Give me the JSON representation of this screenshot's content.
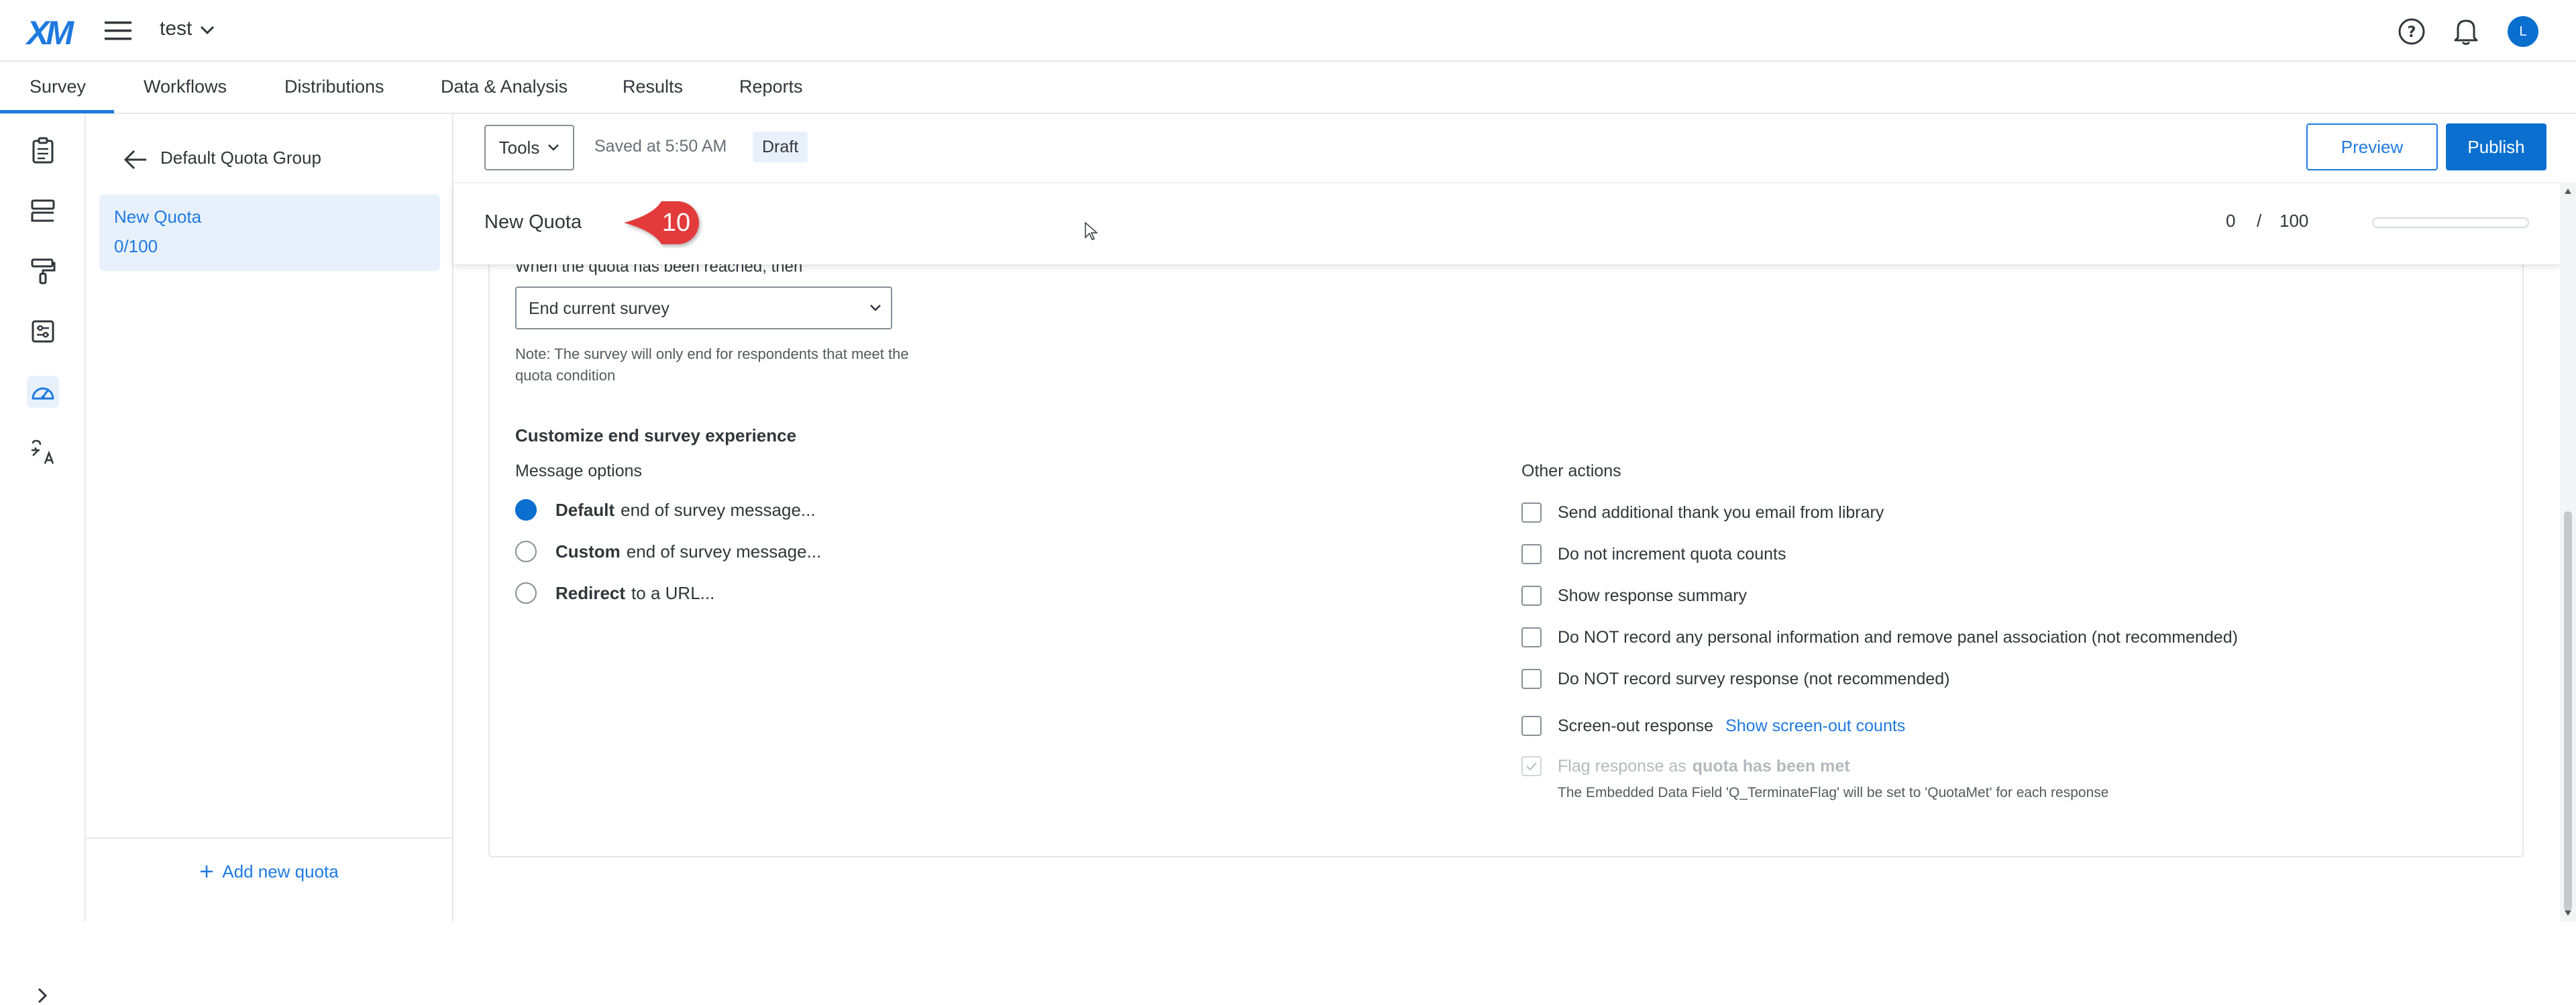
{
  "app": {
    "logo": "XM",
    "project_name": "test",
    "avatar_initial": "L",
    "accent_color": "#1f7ae0"
  },
  "nav": {
    "tabs": [
      {
        "label": "Survey",
        "active": true
      },
      {
        "label": "Workflows"
      },
      {
        "label": "Distributions"
      },
      {
        "label": "Data & Analysis"
      },
      {
        "label": "Results"
      },
      {
        "label": "Reports"
      }
    ]
  },
  "rail": {
    "icons": [
      "survey-clipboard-icon",
      "survey-flow-icon",
      "look-and-feel-paintbrush-icon",
      "survey-options-icon",
      "quotas-gauge-icon",
      "translate-icon"
    ],
    "active_index": 4,
    "expand_icon": "chevron-right-icon"
  },
  "quota_panel": {
    "group_title": "Default Quota Group",
    "quotas": [
      {
        "name": "New Quota",
        "count": "0/100"
      }
    ],
    "add_label": "Add new quota"
  },
  "toolbar": {
    "tools_label": "Tools",
    "saved_text": "Saved at 5:50 AM",
    "status_badge": "Draft",
    "preview_label": "Preview",
    "publish_label": "Publish"
  },
  "quota_header": {
    "name": "New Quota",
    "callout_number": "10",
    "current": "0",
    "separator": "/",
    "total": "100",
    "progress_fraction": 0
  },
  "quota_settings": {
    "reached_label": "When the quota has been reached, then",
    "action_value": "End current survey",
    "note": "Note: The survey will only end for respondents that meet the quota condition",
    "customize_title": "Customize end survey experience",
    "message_options_label": "Message options",
    "message_options": [
      {
        "bold": "Default",
        "rest": "end of survey message...",
        "checked": true
      },
      {
        "bold": "Custom",
        "rest": "end of survey message...",
        "checked": false
      },
      {
        "bold": "Redirect",
        "rest": "to a URL...",
        "checked": false
      }
    ],
    "other_actions_label": "Other actions",
    "other_actions": [
      {
        "label": "Send additional thank you email from library"
      },
      {
        "label": "Do not increment quota counts"
      },
      {
        "label": "Show response summary"
      },
      {
        "label": "Do NOT record any personal information and remove panel association (not recommended)"
      },
      {
        "label": "Do NOT record survey response (not recommended)"
      }
    ],
    "screenout_label": "Screen-out response",
    "screenout_link": "Show screen-out counts",
    "flag_label": "Flag response as",
    "flag_bold": "quota has been met",
    "flag_note": "The Embedded Data Field 'Q_TerminateFlag' will be set to 'QuotaMet' for each response"
  }
}
